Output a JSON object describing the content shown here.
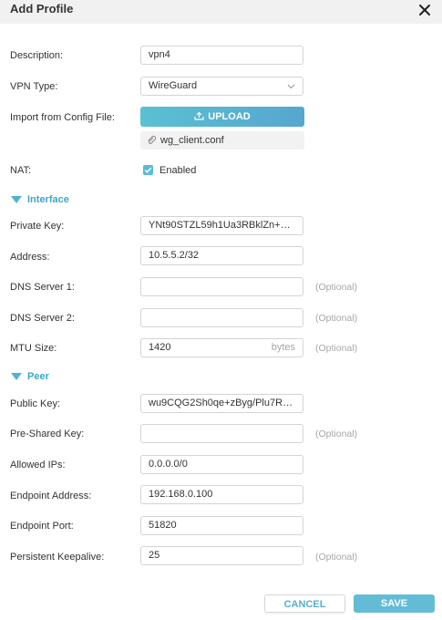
{
  "dialog": {
    "title": "Add Profile"
  },
  "form": {
    "description": {
      "label": "Description:",
      "value": "vpn4"
    },
    "vpn_type": {
      "label": "VPN Type:",
      "value": "WireGuard"
    },
    "import_config": {
      "label": "Import from Config File:",
      "upload_label": "UPLOAD",
      "file_name": "wg_client.conf"
    },
    "nat": {
      "label": "NAT:",
      "checkbox_label": "Enabled",
      "checked": true
    },
    "interface_section": "Interface",
    "private_key": {
      "label": "Private Key:",
      "value": "YNt90STZL59h1Ua3RBklZn+sN..."
    },
    "address": {
      "label": "Address:",
      "value": "10.5.5.2/32"
    },
    "dns1": {
      "label": "DNS Server 1:",
      "value": "",
      "hint": "(Optional)"
    },
    "dns2": {
      "label": "DNS Server 2:",
      "value": "",
      "hint": "(Optional)"
    },
    "mtu": {
      "label": "MTU Size:",
      "value": "1420",
      "unit": "bytes",
      "hint": "(Optional)"
    },
    "peer_section": "Peer",
    "public_key": {
      "label": "Public Key:",
      "value": "wu9CQG2Sh0qe+zByg/Plu7RK..."
    },
    "preshared_key": {
      "label": "Pre-Shared Key:",
      "value": "",
      "hint": "(Optional)"
    },
    "allowed_ips": {
      "label": "Allowed IPs:",
      "value": "0.0.0.0/0"
    },
    "endpoint_address": {
      "label": "Endpoint Address:",
      "value": "192.168.0.100"
    },
    "endpoint_port": {
      "label": "Endpoint Port:",
      "value": "51820"
    },
    "keepalive": {
      "label": "Persistent Keepalive:",
      "value": "25",
      "hint": "(Optional)"
    }
  },
  "buttons": {
    "cancel": "CANCEL",
    "save": "SAVE"
  },
  "colors": {
    "accent": "#5bbad4",
    "section": "#3aa8c8",
    "hint": "#a6a6a6",
    "header_bg": "#f1f1f1"
  },
  "icons": {
    "close": "close-icon",
    "dropdown": "chevron-down-icon",
    "upload": "upload-icon",
    "file": "paperclip-icon",
    "check": "check-icon",
    "section": "triangle-down-icon"
  }
}
